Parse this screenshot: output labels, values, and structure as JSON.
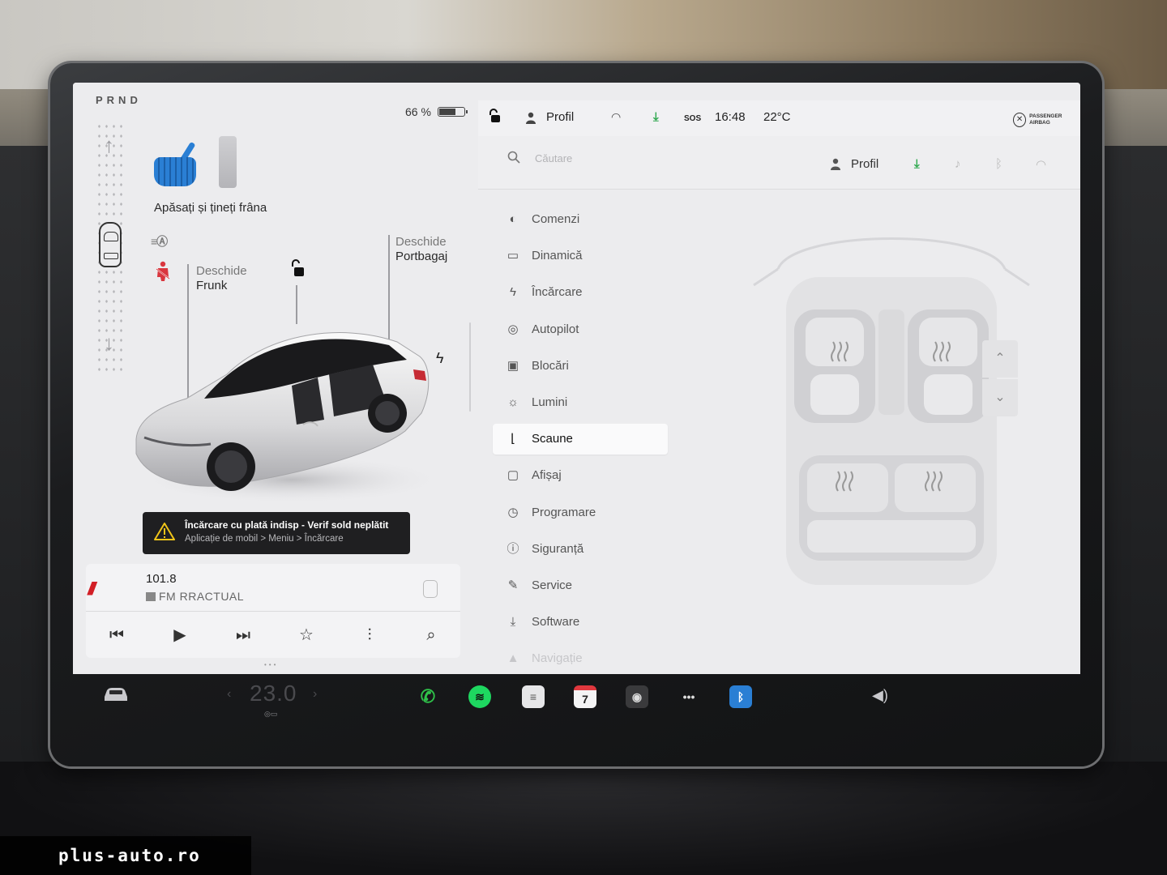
{
  "drive": {
    "gears": "PRND",
    "battery_percent": "66 %",
    "battery_level": 0.66
  },
  "brake": {
    "message": "Apăsați și țineți frâna"
  },
  "frunk": {
    "line1": "Deschide",
    "line2": "Frunk"
  },
  "trunk": {
    "line1": "Deschide",
    "line2": "Portbagaj"
  },
  "alert": {
    "title": "Încărcare cu plată indisp - Verif sold neplătit",
    "subtitle": "Aplicație de mobil > Meniu > Încărcare"
  },
  "media": {
    "logo_text": "Radio România Actualități",
    "frequency": "101.8",
    "station": "FM RRACTUAL"
  },
  "status": {
    "profile": "Profil",
    "sos": "SOS",
    "time": "16:48",
    "temperature": "22°C",
    "airbag": "PASSENGER AIRBAG"
  },
  "settings": {
    "search_placeholder": "Căutare",
    "profile": "Profil",
    "menu": [
      {
        "label": "Comenzi",
        "icon": "toggle-icon"
      },
      {
        "label": "Dinamică",
        "icon": "car-icon"
      },
      {
        "label": "Încărcare",
        "icon": "bolt-icon"
      },
      {
        "label": "Autopilot",
        "icon": "steering-wheel-icon"
      },
      {
        "label": "Blocări",
        "icon": "lock-icon"
      },
      {
        "label": "Lumini",
        "icon": "sun-icon"
      },
      {
        "label": "Scaune",
        "icon": "seat-icon",
        "active": true
      },
      {
        "label": "Afișaj",
        "icon": "display-icon"
      },
      {
        "label": "Programare",
        "icon": "clock-icon"
      },
      {
        "label": "Siguranță",
        "icon": "info-icon"
      },
      {
        "label": "Service",
        "icon": "wrench-icon"
      },
      {
        "label": "Software",
        "icon": "download-icon"
      },
      {
        "label": "Navigație",
        "icon": "navigation-icon"
      }
    ]
  },
  "dock": {
    "cabin_temp": "23.0",
    "calendar_day": "7"
  },
  "watermark": "plus-auto.ro",
  "colors": {
    "accent_blue": "#2a7fd4",
    "download_green": "#2fa84f",
    "alert_bg": "#1f1f21",
    "seat_heat": "#999999"
  }
}
